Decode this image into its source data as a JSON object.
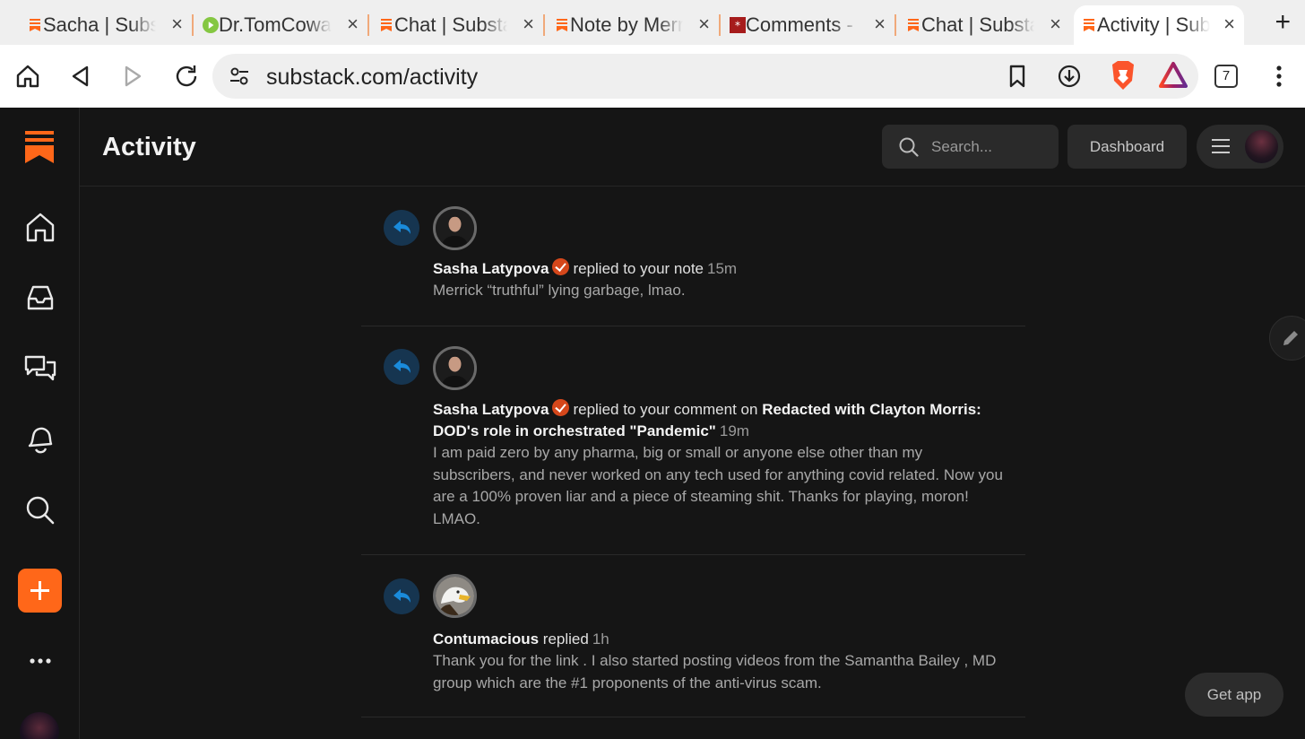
{
  "browser": {
    "tabs": [
      {
        "title": "Sacha | Substack",
        "favicon": "substack-favicon",
        "active": false
      },
      {
        "title": "Dr.TomCowan",
        "favicon": "rumble-favicon",
        "active": false
      },
      {
        "title": "Chat | Substack",
        "favicon": "substack-favicon",
        "active": false
      },
      {
        "title": "Note by Merrick",
        "favicon": "substack-favicon",
        "active": false
      },
      {
        "title": "Comments - ",
        "favicon": "red-square-favicon",
        "active": false
      },
      {
        "title": "Chat | Substack",
        "favicon": "substack-favicon",
        "active": false
      },
      {
        "title": "Activity | Substack",
        "favicon": "substack-favicon",
        "active": true
      }
    ],
    "new_tab_glyph": "+",
    "close_glyph": "×",
    "address": "substack.com/activity",
    "tab_count": "7"
  },
  "app": {
    "page_title": "Activity",
    "search_placeholder": "Search...",
    "dashboard_label": "Dashboard",
    "get_app_label": "Get app",
    "brand_color": "#ff6719",
    "sidebar": [
      "home-icon",
      "inbox-icon",
      "chat-icon",
      "bell-icon",
      "search-icon",
      "compose-plus-icon",
      "more-dots-icon",
      "avatar"
    ]
  },
  "activity": [
    {
      "author": "Sasha Latypova",
      "verified": true,
      "action": "replied to your note",
      "target": "",
      "time": "15m",
      "body": "Merrick “truthful” lying garbage, lmao."
    },
    {
      "author": "Sasha Latypova",
      "verified": true,
      "action": "replied to your comment on",
      "target": "Redacted with Clayton Morris: DOD's role in orchestrated \"Pandemic\"",
      "time": "19m",
      "body": "I am paid zero by any pharma, big or small or anyone else other than my subscribers, and never worked on any tech used for anything covid related. Now you are a 100% proven liar and a piece of steaming shit. Thanks for playing, moron! LMAO."
    },
    {
      "author": "Contumacious",
      "verified": false,
      "action": "replied",
      "target": "",
      "time": "1h",
      "body": "Thank you for the link . I also started posting videos from the Samantha Bailey , MD group which are the #1 proponents of the anti-virus scam."
    }
  ]
}
